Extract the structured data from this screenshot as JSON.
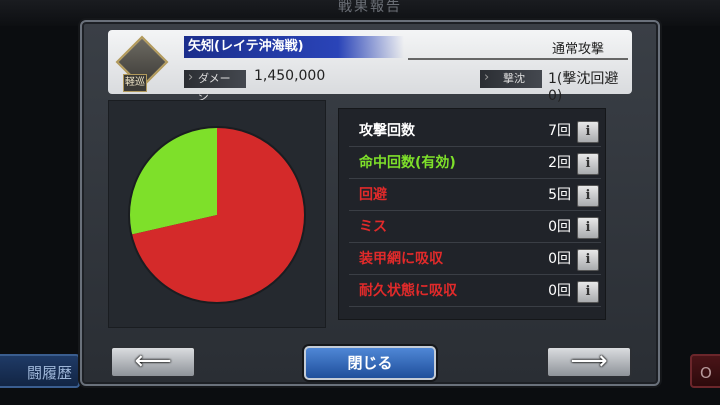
{
  "background": {
    "title": "戦果報告",
    "left_tab": "闘履歴",
    "right_tab": "O"
  },
  "header": {
    "ship_badge": "軽巡",
    "ship_name": "矢矧(レイテ沖海戦)",
    "attack_type": "通常攻撃",
    "damage_label": "ダメージ",
    "damage_value": "1,450,000",
    "sink_label": "撃沈",
    "sink_value": "1(撃沈回避0)"
  },
  "stats": [
    {
      "label": "攻撃回数",
      "value": "7回",
      "color": "#ffffff"
    },
    {
      "label": "命中回数(有効)",
      "value": "2回",
      "color": "#7ee02a"
    },
    {
      "label": "回避",
      "value": "5回",
      "color": "#e02a2a"
    },
    {
      "label": "ミス",
      "value": "0回",
      "color": "#e02a2a"
    },
    {
      "label": "装甲網に吸収",
      "value": "0回",
      "color": "#e02a2a"
    },
    {
      "label": "耐久状態に吸収",
      "value": "0回",
      "color": "#e02a2a"
    }
  ],
  "info_glyph": "i",
  "buttons": {
    "prev": "⟵",
    "close": "閉じる",
    "next": "⟶"
  },
  "chart_data": {
    "type": "pie",
    "slices": [
      {
        "label": "命中",
        "value": 2,
        "color": "#7ee02a"
      },
      {
        "label": "回避",
        "value": 5,
        "color": "#d42a2a"
      }
    ]
  }
}
